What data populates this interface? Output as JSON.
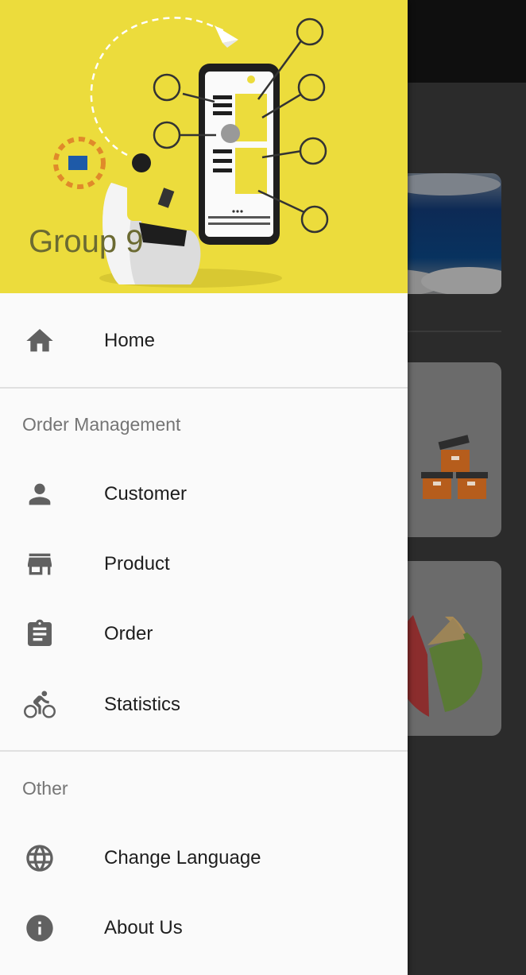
{
  "header": {
    "title": "Group 9",
    "bg_color": "#ecdc3c"
  },
  "nav": {
    "home": {
      "label": "Home",
      "icon": "home-icon"
    },
    "section_order": "Order Management",
    "customer": {
      "label": "Customer",
      "icon": "person-icon"
    },
    "product": {
      "label": "Product",
      "icon": "store-icon"
    },
    "order": {
      "label": "Order",
      "icon": "clipboard-icon"
    },
    "statistics": {
      "label": "Statistics",
      "icon": "bike-icon"
    },
    "section_other": "Other",
    "language": {
      "label": "Change Language",
      "icon": "globe-icon"
    },
    "about": {
      "label": "About Us",
      "icon": "info-icon"
    }
  },
  "colors": {
    "icon": "#616161",
    "accent": "#ecdc3c"
  }
}
